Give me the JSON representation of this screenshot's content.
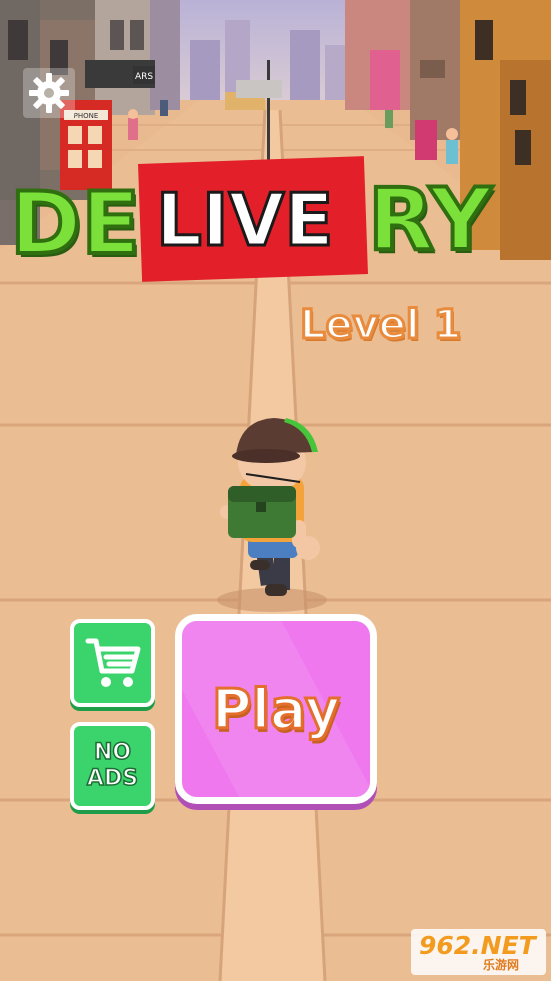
{
  "game": {
    "title_left": "DE",
    "title_middle": "LIVE",
    "title_right": "RY",
    "level_text": "Level 1"
  },
  "buttons": {
    "play_label": "Play",
    "no_ads_line1": "NO",
    "no_ads_line2": "ADS"
  },
  "scene": {
    "phone_booth_sign": "PHONE",
    "shop_sign": "ARS"
  },
  "watermark": {
    "main": "962.NET",
    "sub": "乐游网"
  },
  "icons": {
    "settings": "gear-icon",
    "shop": "shopping-cart-icon"
  },
  "colors": {
    "ground": "#e9b98f",
    "title_green": "#7be03a",
    "live_red": "#e3202a",
    "play_pink": "#ef78ef",
    "button_green": "#3bd46c"
  }
}
